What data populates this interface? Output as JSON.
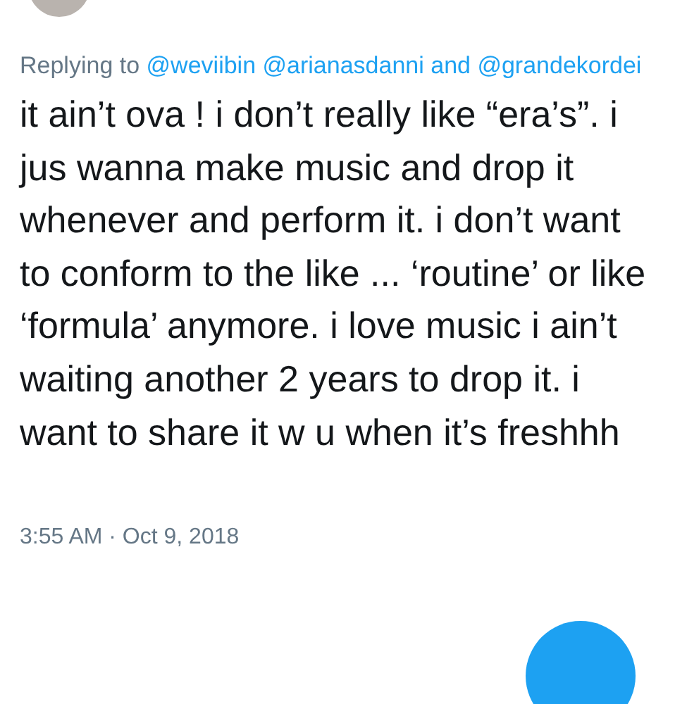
{
  "reply": {
    "label": "Replying to",
    "mentions": [
      "@weviibin",
      "@arianasdanni"
    ],
    "joiner": "and",
    "last_mention": "@grandekordei"
  },
  "tweet_text": "it ain’t ova ! i don’t really like “era’s”. i jus wanna make music and drop it whenever and perform it. i don’t want to conform to the like ... ‘routine’ or like ‘formula’ anymore. i love music i ain’t waiting another 2 years to drop it. i want to share it w u when it’s freshhh",
  "timestamp": "3:55 AM · Oct 9, 2018"
}
